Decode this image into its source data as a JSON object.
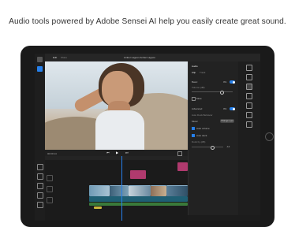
{
  "caption": "Audio tools powered by Adobe Sensei AI help you easily create great sound.",
  "app": {
    "top_title": "Amber Lagoon Amber Lagoon",
    "tabs": {
      "edit": "Edit",
      "share": "Share"
    }
  },
  "right_panel": {
    "section_title": "Audio",
    "tabs": [
      "Clip",
      "Track"
    ],
    "basic_label": "Basic",
    "basic_value": "0%",
    "volume_label": "Volume (dB)",
    "mute_label": "Mute",
    "advanced_label": "Advanced",
    "advanced_value": "0%",
    "auto_duck_label": "Auto Duck Behavior",
    "music_label": "Music",
    "change_type_label": "Change type",
    "auto_volume_label": "Auto volume",
    "auto_duck_check_label": "Auto duck",
    "duck_amount_label": "Duck by (dB)",
    "duck_amount_value": "-12"
  },
  "timeline": {
    "timecode": "00:00:14"
  },
  "colors": {
    "accent": "#2680eb",
    "title_clip": "#b03a6e",
    "video_clip": "#5e89a8",
    "audio_clip": "#1f5f74"
  }
}
